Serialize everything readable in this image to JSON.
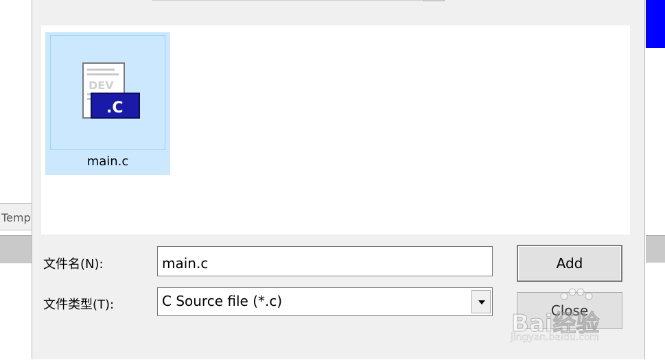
{
  "background": {
    "tab_label": "Temp"
  },
  "file_view": {
    "items": [
      {
        "name": "main.c",
        "icon": "c-source-file-icon",
        "icon_badge": ".C",
        "icon_text": "DEV",
        "selected": true
      }
    ]
  },
  "fields": {
    "file_name_label": "文件名(N):",
    "file_name_value": "main.c",
    "file_type_label": "文件类型(T):",
    "file_type_value": "C Source file (*.c)"
  },
  "buttons": {
    "add_label": "Add",
    "close_label": "Close"
  },
  "watermark": {
    "brand": "Bai经验",
    "url": "jingyan.baidu.com"
  },
  "colors": {
    "selection": "#cce8ff",
    "selection_border": "#99d1ff",
    "dialog_bg": "#f0f0f0",
    "accent_blue": "#0000ff",
    "c_badge": "#1a1aa8"
  }
}
